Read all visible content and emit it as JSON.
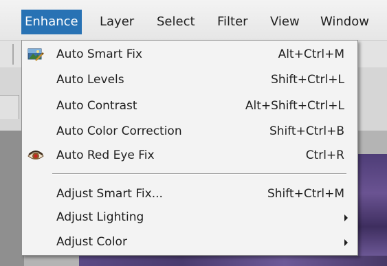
{
  "menubar": {
    "items": [
      {
        "label": "Enhance",
        "active": true
      },
      {
        "label": "Layer"
      },
      {
        "label": "Select"
      },
      {
        "label": "Filter"
      },
      {
        "label": "View"
      },
      {
        "label": "Window"
      }
    ]
  },
  "enhance_menu": {
    "items": [
      {
        "label": "Auto Smart Fix",
        "shortcut": "Alt+Ctrl+M",
        "icon": "auto-smart-fix-icon"
      },
      {
        "label": "Auto Levels",
        "shortcut": "Shift+Ctrl+L"
      },
      {
        "label": "Auto Contrast",
        "shortcut": "Alt+Shift+Ctrl+L"
      },
      {
        "label": "Auto Color Correction",
        "shortcut": "Shift+Ctrl+B"
      },
      {
        "label": "Auto Red Eye Fix",
        "shortcut": "Ctrl+R",
        "icon": "red-eye-icon"
      },
      {
        "label": "Adjust Smart Fix...",
        "shortcut": "Shift+Ctrl+M"
      },
      {
        "label": "Adjust Lighting",
        "submenu": true
      },
      {
        "label": "Adjust Color",
        "submenu": true
      }
    ]
  },
  "colors": {
    "menu_highlight": "#2872b4",
    "menu_background": "#f3f3f3"
  }
}
